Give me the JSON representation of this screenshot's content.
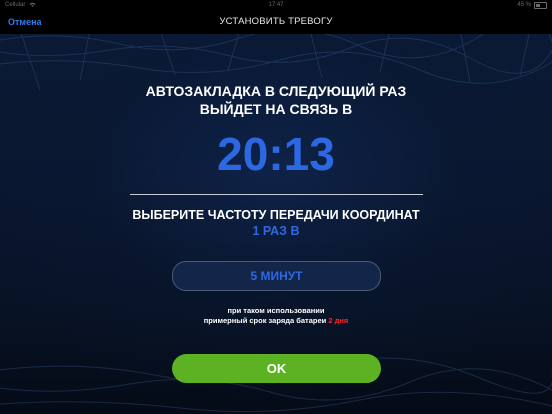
{
  "status_bar": {
    "carrier": "Cellular",
    "time": "17:47",
    "battery": "45 %"
  },
  "nav": {
    "cancel_label": "Отмена",
    "title": "УСТАНОВИТЬ ТРЕВОГУ"
  },
  "main": {
    "heading_line1": "АВТОЗАКЛАДКА В СЛЕДУЮЩИЙ РАЗ",
    "heading_line2": "ВЫЙДЕТ НА СВЯЗЬ В",
    "next_time": "20:13",
    "frequency_heading": "ВЫБЕРИТЕ ЧАСТОТУ ПЕРЕДАЧИ КООРДИНАТ",
    "frequency_sub": "1 РАЗ В",
    "interval_value": "5 МИНУТ",
    "note_line1": "при таком использовании",
    "note_line2_prefix": "примерный срок заряда батареи",
    "note_days": "2 дня",
    "ok_label": "OK"
  },
  "colors": {
    "accent_blue": "#2d68e3",
    "ok_green": "#5db224",
    "warning_red": "#ff2a2a"
  }
}
